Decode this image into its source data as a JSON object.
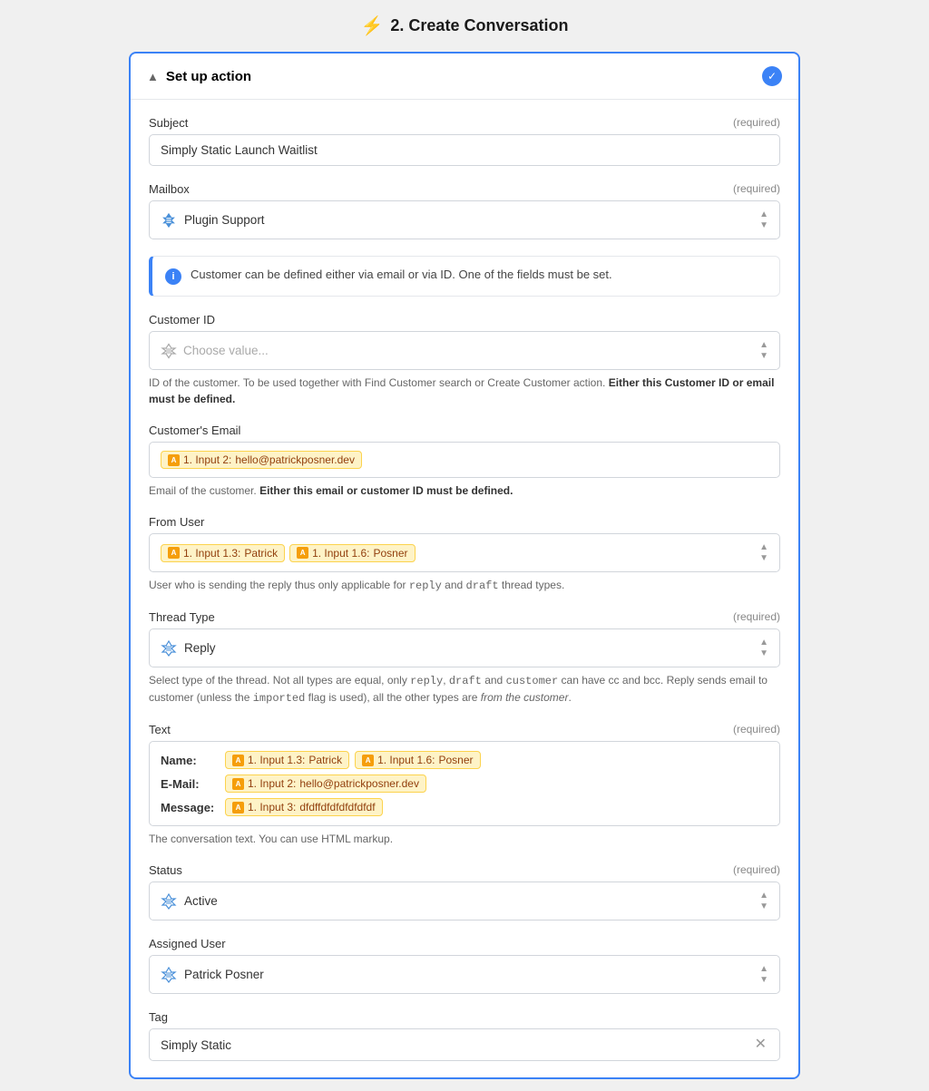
{
  "page": {
    "title": "2. Create Conversation",
    "title_icon": "⚡"
  },
  "header": {
    "collapse_label": "Set up action",
    "check_icon": "✓"
  },
  "fields": {
    "subject": {
      "label": "Subject",
      "required": "(required)",
      "value": "Simply Static Launch Waitlist"
    },
    "mailbox": {
      "label": "Mailbox",
      "required": "(required)",
      "value": "Plugin Support"
    },
    "info_message": "Customer can be defined either via email or via ID. One of the fields must be set.",
    "customer_id": {
      "label": "Customer ID",
      "placeholder": "Choose value...",
      "hint": "ID of the customer. To be used together with Find Customer search or Create Customer action.",
      "hint_bold": "Either this Customer ID or email must be defined."
    },
    "customer_email": {
      "label": "Customer's Email",
      "token_label": "1. Input 2:",
      "token_value": "hello@patrickposner.dev",
      "hint": "Email of the customer.",
      "hint_bold": "Either this email or customer ID must be defined."
    },
    "from_user": {
      "label": "From User",
      "token1_label": "1. Input 1.3:",
      "token1_value": "Patrick",
      "token2_label": "1. Input 1.6:",
      "token2_value": "Posner",
      "hint": "User who is sending the reply thus only applicable for reply and draft thread types."
    },
    "thread_type": {
      "label": "Thread Type",
      "required": "(required)",
      "value": "Reply",
      "hint_prefix": "Select type of the thread. Not all types are equal, only",
      "hint_code1": "reply",
      "hint_code2": "draft",
      "hint_code3": "customer",
      "hint_mid": "can have cc and bcc. Reply sends email to customer (unless the",
      "hint_code4": "imported",
      "hint_suffix": "flag is used), all the other types are from the customer."
    },
    "text": {
      "label": "Text",
      "required": "(required)",
      "rows": [
        {
          "label": "Name:",
          "tokens": [
            {
              "label": "1. Input 1.3:",
              "value": "Patrick"
            },
            {
              "label": "1. Input 1.6:",
              "value": "Posner"
            }
          ]
        },
        {
          "label": "E-Mail:",
          "tokens": [
            {
              "label": "1. Input 2:",
              "value": "hello@patrickposner.dev"
            }
          ]
        },
        {
          "label": "Message:",
          "tokens": [
            {
              "label": "1. Input 3:",
              "value": "dfdffdfdfdfdfdfdf"
            }
          ]
        }
      ],
      "hint": "The conversation text. You can use HTML markup."
    },
    "status": {
      "label": "Status",
      "required": "(required)",
      "value": "Active"
    },
    "assigned_user": {
      "label": "Assigned User",
      "value": "Patrick Posner"
    },
    "tag": {
      "label": "Tag",
      "value": "Simply Static"
    }
  }
}
